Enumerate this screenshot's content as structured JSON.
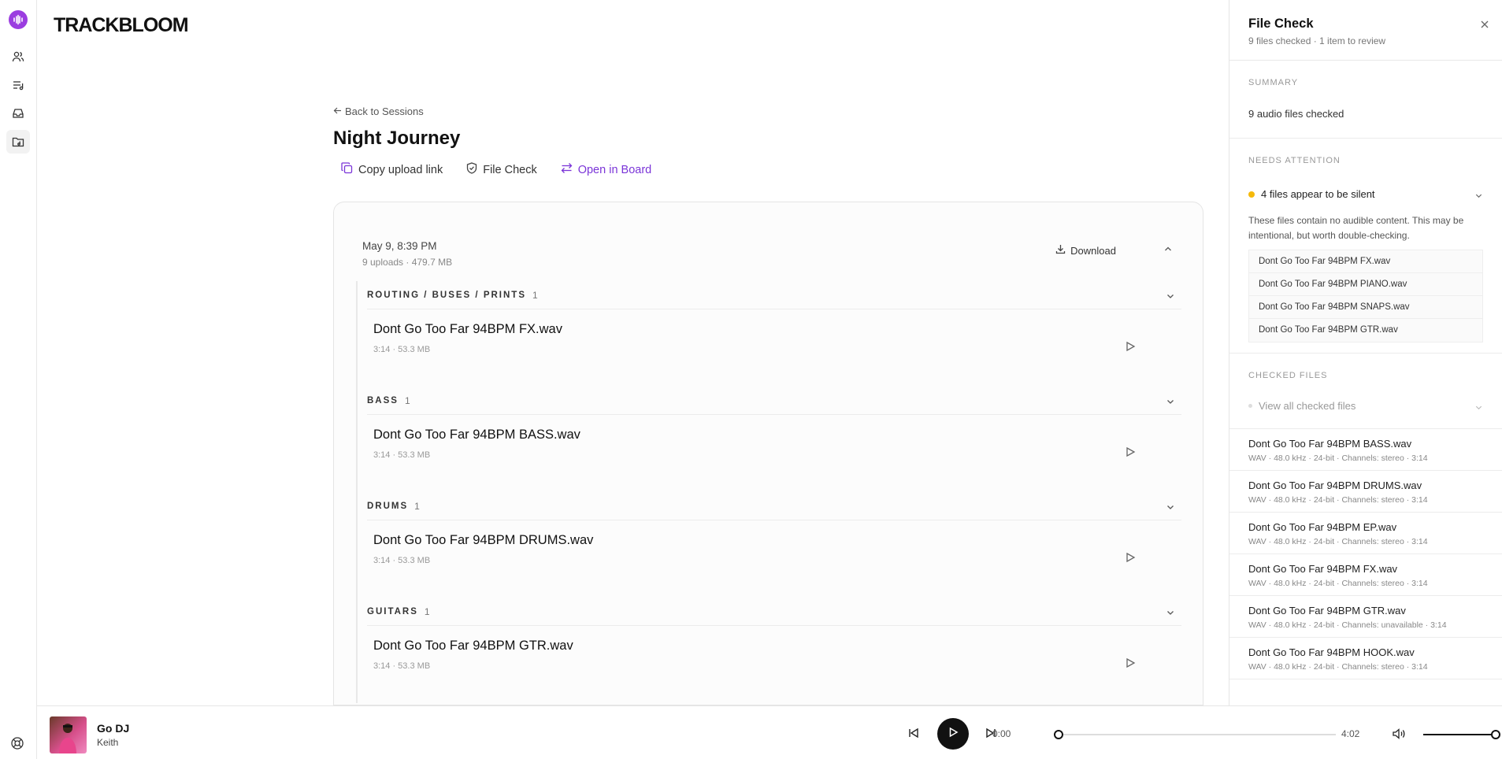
{
  "app": {
    "brand": "TRACKBLOOM",
    "nav_icons": [
      "users-icon",
      "playlist-icon",
      "inbox-icon",
      "folder-music-icon"
    ],
    "accent": "#7b35d8"
  },
  "session": {
    "back_label": "Back to Sessions",
    "title": "Night Journey",
    "actions": {
      "copy_link": "Copy upload link",
      "file_check": "File Check",
      "open_board": "Open in Board"
    },
    "upload": {
      "date": "May 9, 8:39 PM",
      "meta": "9 uploads · 479.7 MB",
      "download": "Download"
    },
    "groups": [
      {
        "name": "ROUTING / BUSES / PRINTS",
        "count": "1",
        "file": "Dont Go Too Far 94BPM FX.wav",
        "meta": "3:14 · 53.3 MB"
      },
      {
        "name": "BASS",
        "count": "1",
        "file": "Dont Go Too Far 94BPM BASS.wav",
        "meta": "3:14 · 53.3 MB"
      },
      {
        "name": "DRUMS",
        "count": "1",
        "file": "Dont Go Too Far 94BPM DRUMS.wav",
        "meta": "3:14 · 53.3 MB"
      },
      {
        "name": "GUITARS",
        "count": "1",
        "file": "Dont Go Too Far 94BPM GTR.wav",
        "meta": "3:14 · 53.3 MB"
      }
    ]
  },
  "panel": {
    "title": "File Check",
    "subtitle": "9 files checked · 1 item to review",
    "summary_label": "SUMMARY",
    "summary_text": "9 audio files checked",
    "attention_label": "NEEDS ATTENTION",
    "attention_title": "4 files appear to be silent",
    "attention_desc": "These files contain no audible content. This may be intentional, but worth double-checking.",
    "attention_files": [
      "Dont Go Too Far 94BPM FX.wav",
      "Dont Go Too Far 94BPM PIANO.wav",
      "Dont Go Too Far 94BPM SNAPS.wav",
      "Dont Go Too Far 94BPM GTR.wav"
    ],
    "checked_label": "CHECKED FILES",
    "view_all": "View all checked files",
    "checked_files": [
      {
        "name": "Dont Go Too Far 94BPM BASS.wav",
        "meta": "WAV · 48.0 kHz · 24-bit · Channels: stereo · 3:14"
      },
      {
        "name": "Dont Go Too Far 94BPM DRUMS.wav",
        "meta": "WAV · 48.0 kHz · 24-bit · Channels: stereo · 3:14"
      },
      {
        "name": "Dont Go Too Far 94BPM EP.wav",
        "meta": "WAV · 48.0 kHz · 24-bit · Channels: stereo · 3:14"
      },
      {
        "name": "Dont Go Too Far 94BPM FX.wav",
        "meta": "WAV · 48.0 kHz · 24-bit · Channels: stereo · 3:14"
      },
      {
        "name": "Dont Go Too Far 94BPM GTR.wav",
        "meta": "WAV · 48.0 kHz · 24-bit · Channels: unavailable · 3:14"
      },
      {
        "name": "Dont Go Too Far 94BPM HOOK.wav",
        "meta": "WAV · 48.0 kHz · 24-bit · Channels: stereo · 3:14"
      }
    ]
  },
  "player": {
    "title": "Go DJ",
    "artist": "Keith",
    "current_time": "0:00",
    "total_time": "4:02",
    "progress": 0,
    "volume": 1.0
  }
}
